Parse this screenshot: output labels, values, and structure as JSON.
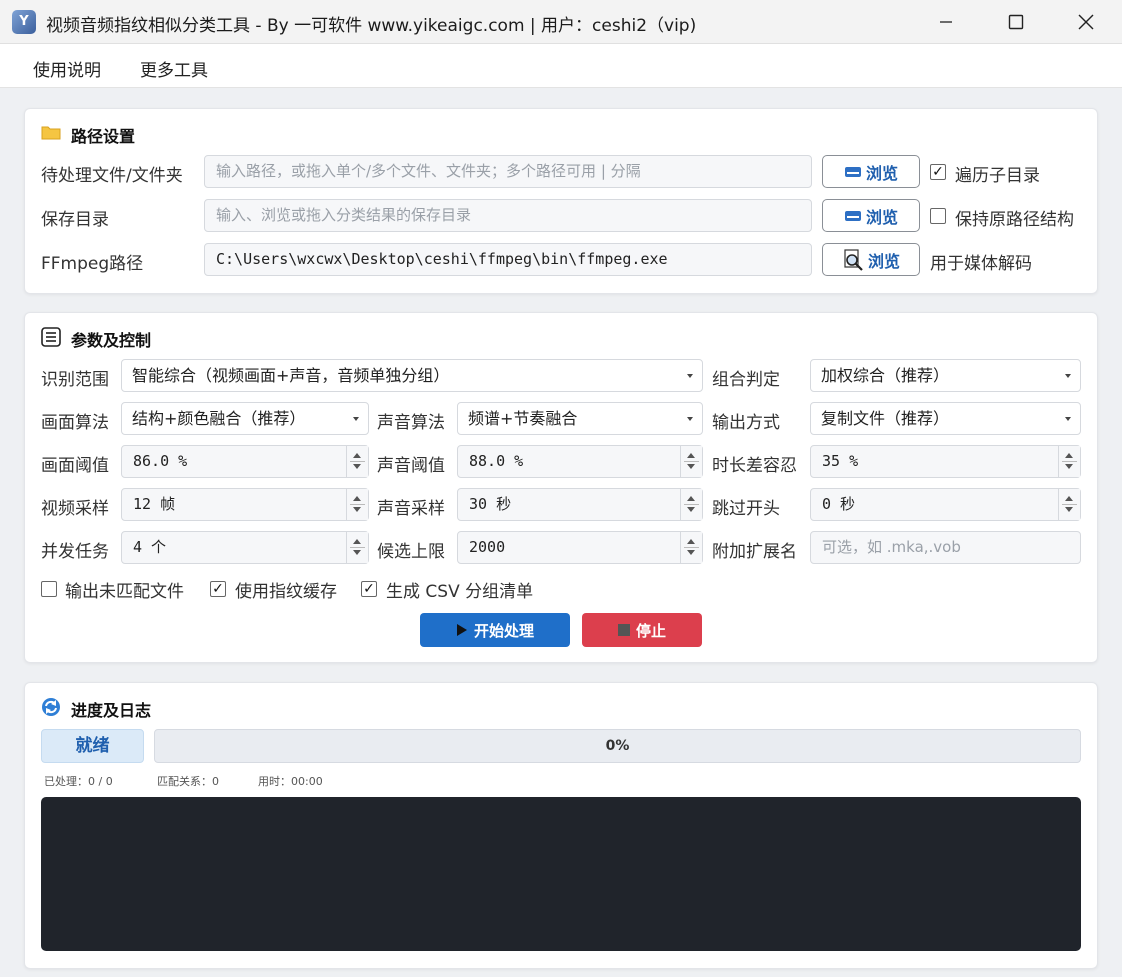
{
  "window": {
    "icon_text": "Y",
    "title": "视频音频指纹相似分类工具 - By 一可软件 www.yikeaigc.com | 用户：ceshi2（vip)"
  },
  "menu": [
    "使用说明",
    "更多工具"
  ],
  "path_section": {
    "title": "路径设置",
    "input": {
      "label": "待处理文件/文件夹",
      "value": "",
      "placeholder": "输入路径，或拖入单个/多个文件、文件夹；多个路径可用 | 分隔"
    },
    "output": {
      "label": "保存目录",
      "value": "",
      "placeholder": "输入、浏览或拖入分类结果的保存目录"
    },
    "ffmpeg": {
      "label": "FFmpeg路径",
      "value": "C:\\Users\\wxcwx\\Desktop\\ceshi\\ffmpeg\\bin\\ffmpeg.exe"
    },
    "browse_label": "浏览",
    "recurse": {
      "label": "遍历子目录",
      "checked": true
    },
    "keep_structure": {
      "label": "保持原路径结构",
      "checked": false
    },
    "ffmpeg_note": "用于媒体解码"
  },
  "params_section": {
    "title": "参数及控制",
    "scope": {
      "label": "识别范围",
      "value": "智能综合（视频画面+声音，音频单独分组）"
    },
    "combine": {
      "label": "组合判定",
      "value": "加权综合（推荐）"
    },
    "image_algo": {
      "label": "画面算法",
      "value": "结构+颜色融合（推荐）"
    },
    "audio_algo": {
      "label": "声音算法",
      "value": "频谱+节奏融合"
    },
    "output_mode": {
      "label": "输出方式",
      "value": "复制文件（推荐）"
    },
    "image_threshold": {
      "label": "画面阈值",
      "value": "86.0 %"
    },
    "audio_threshold": {
      "label": "声音阈值",
      "value": "88.0 %"
    },
    "duration_tol": {
      "label": "时长差容忍",
      "value": "35 %"
    },
    "video_sample": {
      "label": "视频采样",
      "value": "12 帧"
    },
    "audio_sample": {
      "label": "声音采样",
      "value": "30 秒"
    },
    "skip_start": {
      "label": "跳过开头",
      "value": "0 秒"
    },
    "concurrency": {
      "label": "并发任务",
      "value": "4 个"
    },
    "candidate_limit": {
      "label": "候选上限",
      "value": "2000"
    },
    "extra_ext": {
      "label": "附加扩展名",
      "value": "",
      "placeholder": "可选，如 .mka,.vob"
    },
    "opt_unmatched": {
      "label": "输出未匹配文件",
      "checked": false
    },
    "opt_cache": {
      "label": "使用指纹缓存",
      "checked": true
    },
    "opt_csv": {
      "label": "生成 CSV 分组清单",
      "checked": true
    },
    "start_label": "开始处理",
    "stop_label": "停止"
  },
  "progress_section": {
    "title": "进度及日志",
    "status": "就绪",
    "progress": 0,
    "progress_text": "0%",
    "processed": "已处理：0 / 0",
    "matches": "匹配关系：0",
    "elapsed": "用时：00:00",
    "log": ""
  },
  "colors": {
    "accent": "#1f6fc9",
    "stop": "#dc3f4d",
    "log_bg": "#20242b"
  }
}
